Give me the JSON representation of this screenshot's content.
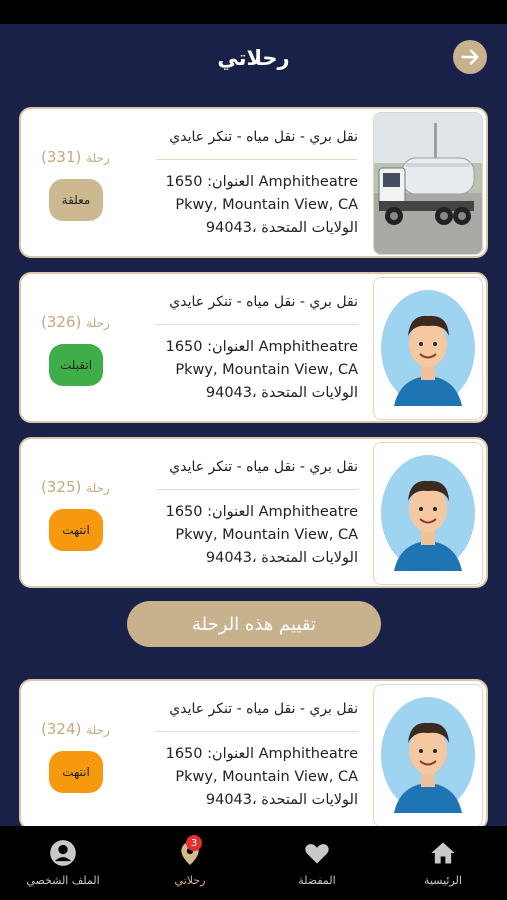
{
  "header": {
    "title": "رحلاتي",
    "back_icon": "arrow-right-icon"
  },
  "trips": [
    {
      "service": "نقل بري - نقل مياه - تنكر عايدي",
      "addr1": "العنوان: 1650 Amphitheatre",
      "addr2": "Pkwy, Mountain View, CA",
      "addr3": "94043، الولايات المتحدة",
      "trip_label": "رحلة",
      "trip_no": "(331)",
      "status": "معلقة",
      "status_color": "#cdb98f",
      "image": "water-truck"
    },
    {
      "service": "نقل بري - نقل مياه - تنكر عايدي",
      "addr1": "العنوان: 1650 Amphitheatre",
      "addr2": "Pkwy, Mountain View, CA",
      "addr3": "94043، الولايات المتحدة",
      "trip_label": "رحلة",
      "trip_no": "(326)",
      "status": "اتقبلت",
      "status_color": "#3fae49",
      "image": "avatar"
    },
    {
      "service": "نقل بري - نقل مياه - تنكر عايدي",
      "addr1": "العنوان: 1650 Amphitheatre",
      "addr2": "Pkwy, Mountain View, CA",
      "addr3": "94043، الولايات المتحدة",
      "trip_label": "رحلة",
      "trip_no": "(325)",
      "status": "انتهت",
      "status_color": "#f7990f",
      "image": "avatar"
    },
    {
      "service": "نقل بري - نقل مياه - تنكر عايدي",
      "addr1": "العنوان: 1650 Amphitheatre",
      "addr2": "Pkwy, Mountain View, CA",
      "addr3": "94043، الولايات المتحدة",
      "trip_label": "رحلة",
      "trip_no": "(324)",
      "status": "انتهت",
      "status_color": "#f7990f",
      "image": "avatar"
    }
  ],
  "rate_button": "تقييم هذه الرحلة",
  "tabs": [
    {
      "label": "الرئيسية",
      "icon": "home-icon"
    },
    {
      "label": "المفضلة",
      "icon": "heart-icon"
    },
    {
      "label": "رحلاتي",
      "icon": "location-pin-icon",
      "badge": "3",
      "active": true
    },
    {
      "label": "الملف الشخصي",
      "icon": "user-icon"
    }
  ],
  "colors": {
    "background": "#1a2148",
    "accent": "#c8b28e",
    "badge": "#e0312f"
  }
}
